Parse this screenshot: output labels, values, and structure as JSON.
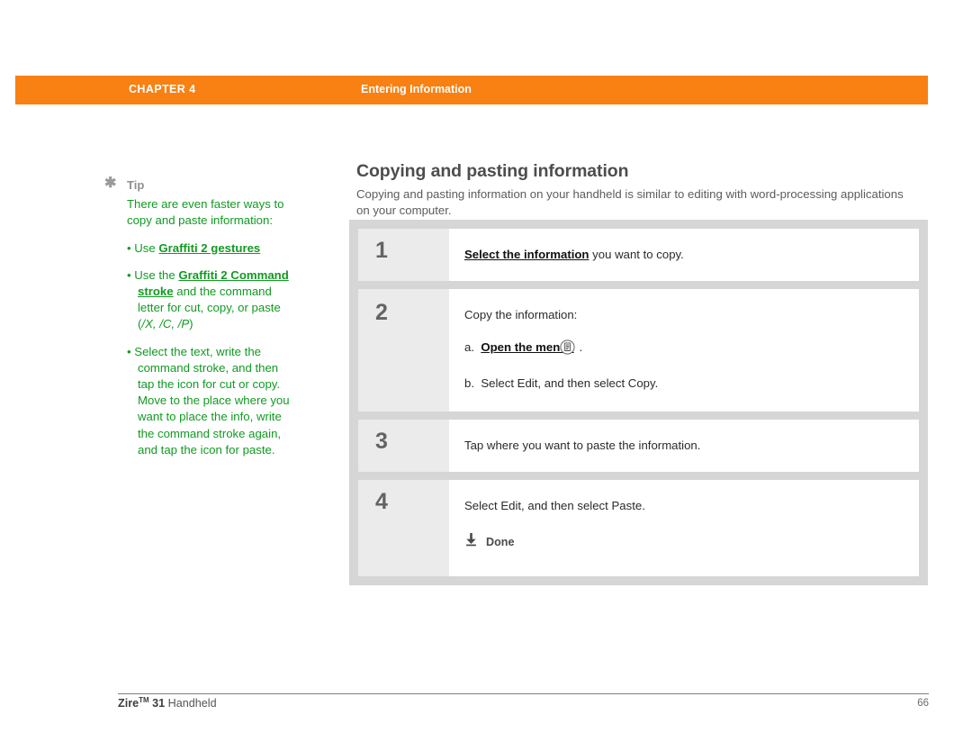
{
  "header": {
    "chapter_label": "CHAPTER 4",
    "section_label": "Entering Information",
    "bar_color": "#f98012"
  },
  "tip": {
    "asterisk_icon": "asterisk-icon",
    "title": "Tip",
    "intro": "There are even faster ways to copy and paste information:",
    "bullets": [
      {
        "prefix": "•  Use ",
        "link": "Graffiti 2 gestures",
        "suffix": ""
      },
      {
        "prefix": "•  Use the ",
        "link": "Graffiti 2 Command stroke",
        "suffix": " and the command letter for cut, copy, or paste (",
        "italic": "/X, /C, /P",
        "tail": ")"
      },
      {
        "prefix": "•  Select the text, write the command stroke, and then tap the icon for cut or copy. Move to the place where you want to place the info, write the command stroke again, and tap the icon for paste.",
        "link": "",
        "suffix": ""
      }
    ],
    "text_color": "#119a22"
  },
  "main": {
    "title": "Copying and pasting information",
    "intro": "Copying and pasting information on your handheld is similar to editing with word-processing applications on your computer.",
    "steps": [
      {
        "number": "1",
        "lines": [
          {
            "link": "Select the information",
            "text": " you want to copy."
          }
        ]
      },
      {
        "number": "2",
        "lines": [
          {
            "link": "",
            "text": "Copy the information:"
          }
        ],
        "sublines": [
          {
            "marker": "a.",
            "link": "Open the menus",
            "text": "",
            "icon": "menu-icon",
            "tail": "."
          },
          {
            "marker": "b.",
            "link": "",
            "text": "Select Edit, and then select Copy."
          }
        ]
      },
      {
        "number": "3",
        "lines": [
          {
            "link": "",
            "text": "Tap where you want to paste the information."
          }
        ]
      },
      {
        "number": "4",
        "lines": [
          {
            "link": "",
            "text": "Select Edit, and then select Paste."
          }
        ],
        "done": {
          "icon": "download-arrow-icon",
          "label": "Done"
        }
      }
    ]
  },
  "footer": {
    "product": "Zire",
    "trademark": "TM",
    "model": " 31",
    "product_suffix": " Handheld",
    "page_number": "66"
  }
}
